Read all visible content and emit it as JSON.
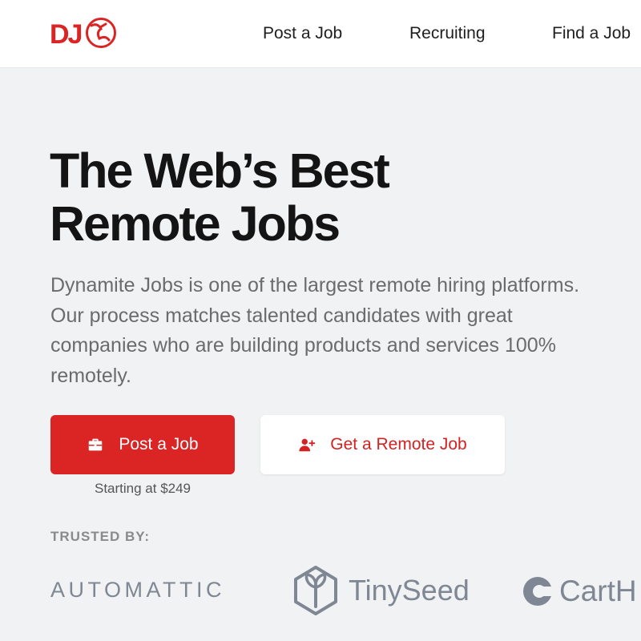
{
  "header": {
    "logo_text": "DJ",
    "nav": [
      {
        "label": "Post a Job"
      },
      {
        "label": "Recruiting"
      },
      {
        "label": "Find a Job"
      }
    ]
  },
  "hero": {
    "title_line1": "The Web’s Best",
    "title_line2": "Remote Jobs",
    "description_lines": [
      "Dynamite Jobs is one of the largest remote hiring platforms.",
      "Our process matches talented candidates with great",
      "companies who are building products and services 100%",
      "remotely."
    ]
  },
  "actions": {
    "primary_label": "Post a Job",
    "primary_icon": "briefcase-icon",
    "secondary_label": "Get a Remote Job",
    "secondary_icon": "user-plus-icon",
    "price_note": "Starting at $249"
  },
  "trusted": {
    "label": "TRUSTED BY:",
    "brands": [
      {
        "name": "AUTOMATTIC"
      },
      {
        "name": "TinySeed"
      },
      {
        "name": "CartH"
      }
    ]
  },
  "colors": {
    "brand_red": "#db2424",
    "page_bg": "#f1f2f4",
    "logo_gray": "#7e8793"
  }
}
